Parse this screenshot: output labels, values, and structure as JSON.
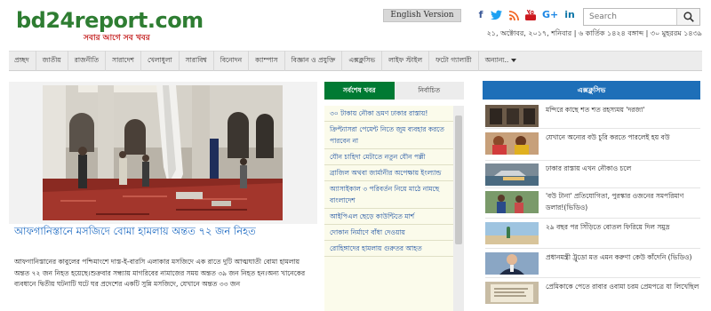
{
  "site": {
    "logo_text": "bd24report.com",
    "tagline": "সবার আগে সব খবর",
    "language_button": "English Version"
  },
  "social": {
    "icons": [
      "facebook-icon",
      "twitter-icon",
      "rss-icon",
      "youtube-icon",
      "google-plus-icon",
      "linkedin-icon"
    ],
    "colors": {
      "facebook": "#3b5998",
      "twitter": "#1da1f2",
      "rss": "#f26522",
      "youtube": "#cc181e",
      "google_plus": "#1e88e5",
      "linkedin": "#0e76a8"
    }
  },
  "search": {
    "placeholder": "Search",
    "button_icon": "search-icon"
  },
  "dateline": "২১, অক্টোবর, ২০১৭, শনিবার | ৬ কার্তিক ১৪২৪ বঙ্গাব্দ | ৩০ মুহররম ১৪৩৯",
  "nav": {
    "items": [
      "প্রচ্ছদ",
      "জাতীয়",
      "রাজনীতি",
      "সারাদেশ",
      "খেলাধুলা",
      "সারাবিশ্ব",
      "বিনোদন",
      "ক্যাম্পাস",
      "বিজ্ঞান ও প্রযুক্তি",
      "এক্সক্লুসিভ",
      "লাইফ স্টাইল",
      "ফটো গ্যালারী",
      "অন্যান্য.."
    ]
  },
  "lead": {
    "title": "আফগানিস্তানে মসজিদে বোমা হামলায় অন্তত ৭২ জন নিহত",
    "summary": "আফগানিস্তানের কাবুলের পশ্চিমাংশে দাস্ত-ই-বারসি এলাকার মসজিদে এক রাতে দুটি আত্মঘাতী বোমা হামলায় অন্তত ৭২ জন নিহত হয়েছে।শুক্রবার সন্ধ্যায় মাগরিবের নামাজের সময় অন্তত ৩৯ জন নিহত হন।অন্য খানেকের ব্যবধানে দ্বিতীয় ঘটনাটি ঘটে ঘর প্রদেশের একটি সুন্নি মসজিদে, যেখানে অন্তত ৩৩ জন"
  },
  "latest": {
    "tab_active": "সর্বশেষ খবর",
    "tab_inactive": "নির্বাচিত",
    "items": [
      "৩০ টাকায় নৌকা ভ্রমণ ঢাকার রাস্তায়!",
      "ক্রিপ্ট্যাসরা পেমেন্ট নিতে জুম ব্যবহার করতে পারবেন না",
      "যৌন চাহিদা মেটাতে নতুন যৌন পল্লী",
      "ব্রাজিল অথবা জার্মানীর অপেক্ষায় ইংল্যান্ড",
      "অ্যাসাইকাল ৩ পরিবর্তন নিয়ে মাঠে নামছে বাংলাদেশ",
      "আইপিএল ছেড়ে কাউন্টিতে মার্শ",
      "দোকান নির্মাণে বাঁধা দেওয়ায়",
      "রোহিঙ্গাদের হামলায় গুরুতর আহত"
    ]
  },
  "exclusive": {
    "heading": "এক্সক্লুসিভ",
    "items": [
      "মন্দিরে কাছে শত শত রহস্যময় 'দরজা'",
      "যেখানে অন্যের বউ চুরি করতে পারলেই হয় বউ",
      "ঢাকার রাস্তায় এখন নৌকাও চলে",
      "'বউ টানা' প্রতিযোগিতা, পুরস্কার ওজনের সমপরিমাণ ডলার!(ভিডিও)",
      "২৯ বছর পর সিঁড়িতে বোতল ফিরিয়ে দিল সমুদ্র",
      "প্রধানমন্ত্রী ট্রুডো মত এমন করুণা কেউ কাঁদেনি (ভিডিও)",
      "প্রেমিকাকে পেতে রাবার ওবামা চরম প্রেমপত্রে যা লিখেছিল"
    ]
  }
}
